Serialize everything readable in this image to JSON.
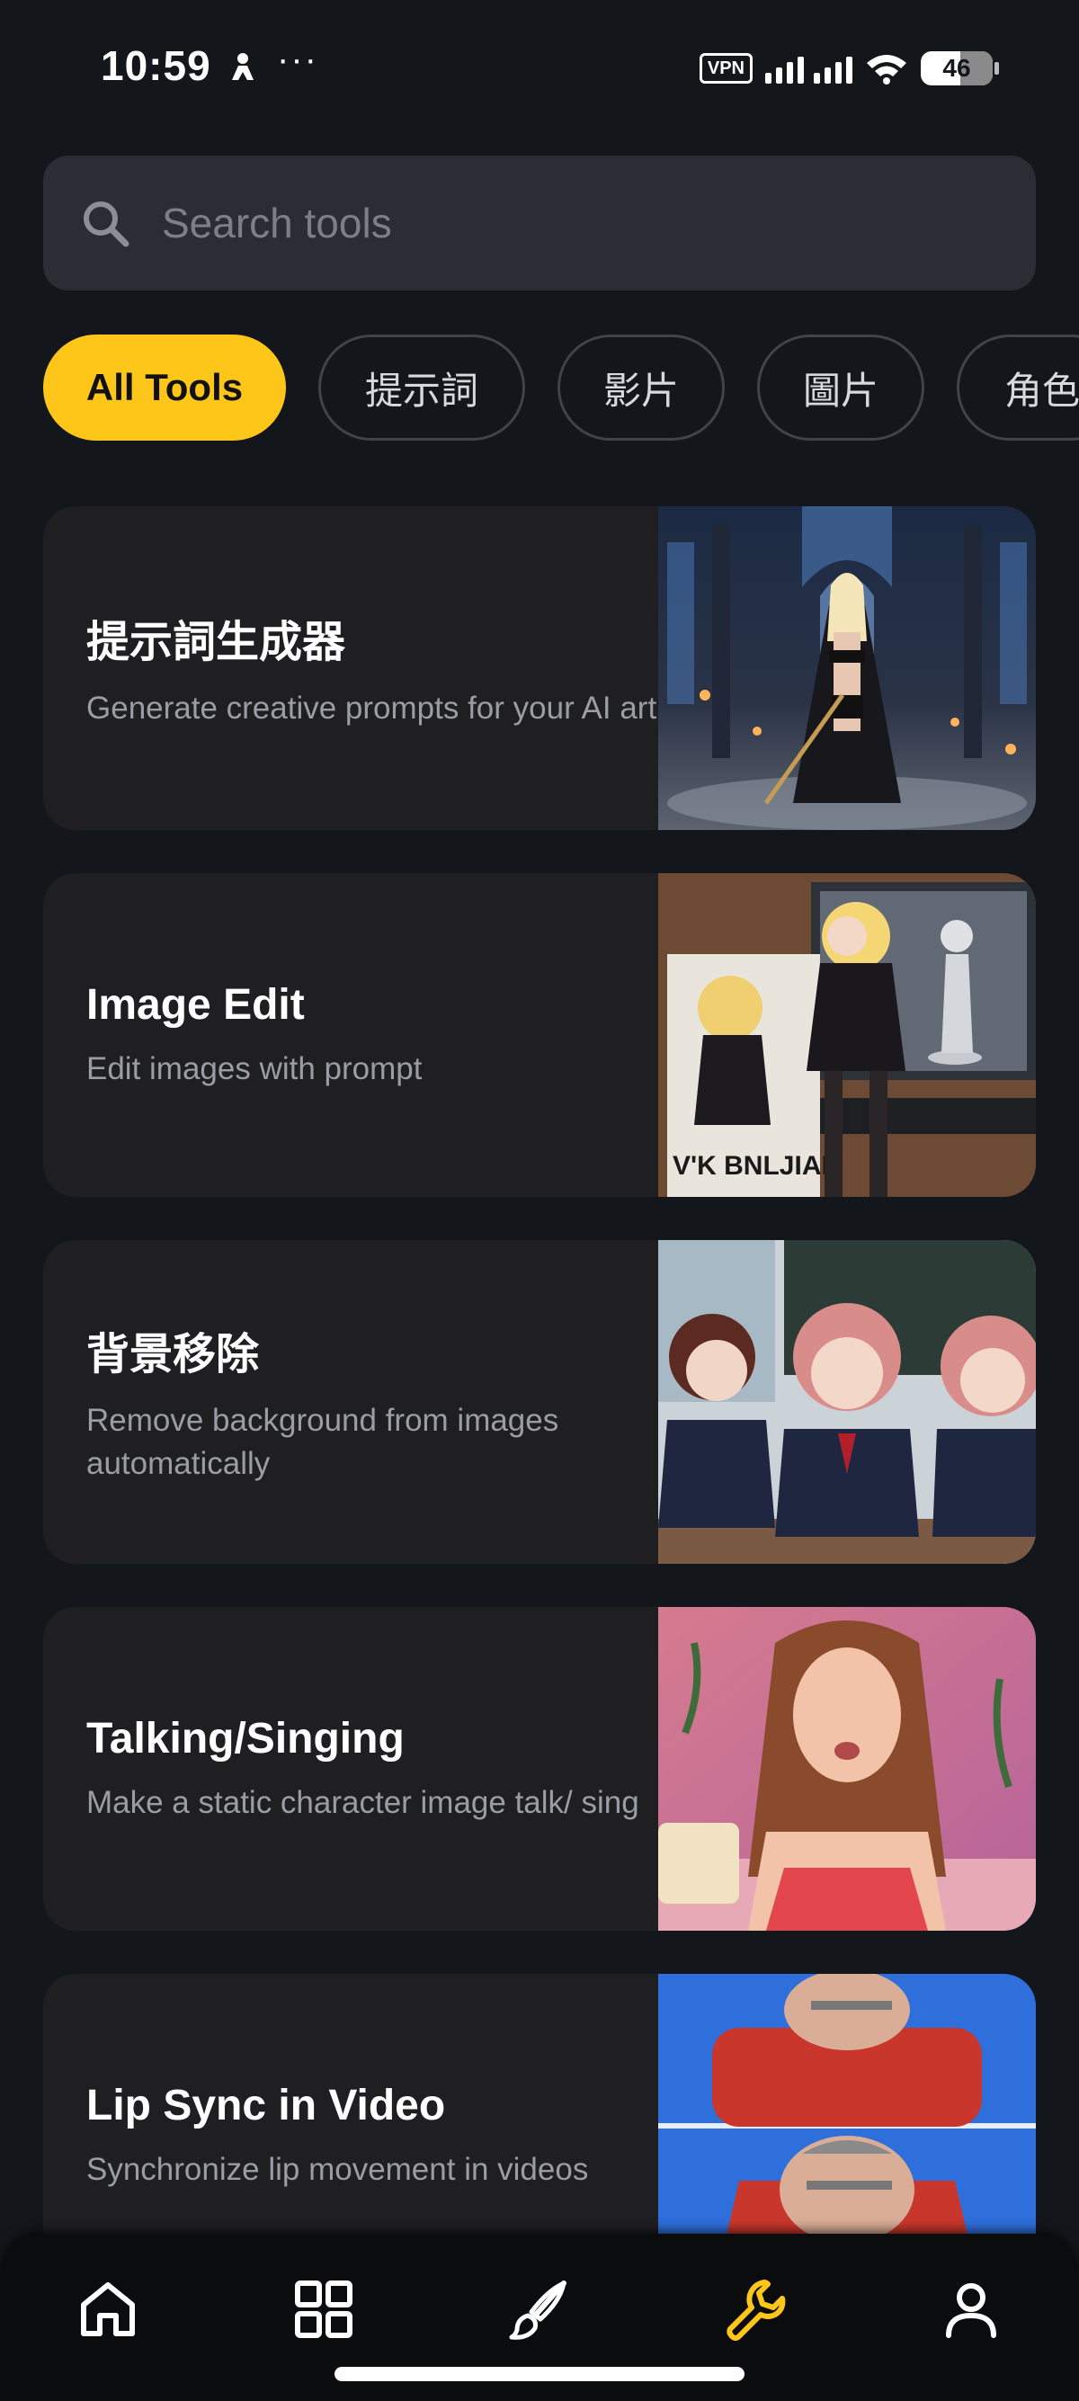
{
  "status_bar": {
    "time": "10:59",
    "dots": "···",
    "vpn": "VPN",
    "battery": "46",
    "icons": [
      "person-icon",
      "signal-icon",
      "wifi-icon",
      "battery-icon"
    ]
  },
  "search": {
    "placeholder": "Search tools",
    "icon": "search-icon"
  },
  "chips": [
    {
      "label": "All Tools",
      "active": true
    },
    {
      "label": "提示詞",
      "active": false
    },
    {
      "label": "影片",
      "active": false
    },
    {
      "label": "圖片",
      "active": false
    },
    {
      "label": "角色",
      "active": false
    }
  ],
  "tools": [
    {
      "title": "提示詞生成器",
      "description": "Generate creative prompts for your AI art"
    },
    {
      "title": "Image Edit",
      "description": "Edit images with prompt"
    },
    {
      "title": "背景移除",
      "description": "Remove background from images automatically"
    },
    {
      "title": "Talking/Singing",
      "description": "Make a static character image talk/ sing"
    },
    {
      "title": "Lip Sync in Video",
      "description": "Synchronize lip movement in videos"
    }
  ],
  "bottom_nav": {
    "items": [
      "home-icon",
      "grid-icon",
      "brush-icon",
      "wrench-icon",
      "user-icon"
    ],
    "active": "wrench-icon",
    "colors": {
      "active": "#ffc61a",
      "inactive": "#ffffff"
    }
  },
  "colors": {
    "background": "#13161b",
    "accent": "#ffc61a",
    "card": "#1f1f22"
  }
}
